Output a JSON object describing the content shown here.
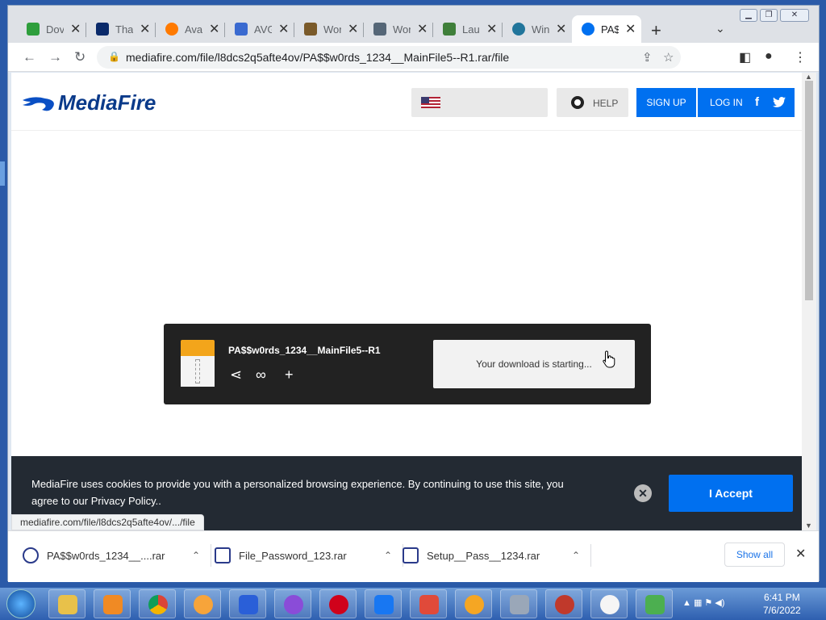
{
  "tabs": [
    {
      "label": "Dov",
      "color": "#2e9e3c"
    },
    {
      "label": "That",
      "color": "#0a2a6a"
    },
    {
      "label": "Ava",
      "color": "#ff7a00"
    },
    {
      "label": "AVG",
      "color": "#3a6ad0"
    },
    {
      "label": "Wor",
      "color": "#7a5a2a"
    },
    {
      "label": "Wor",
      "color": "#556677"
    },
    {
      "label": "Lau",
      "color": "#3f7f3a"
    },
    {
      "label": "Win",
      "color": "#21759b"
    },
    {
      "label": "PA$",
      "color": "#0070f0",
      "active": true
    }
  ],
  "address": {
    "url": "mediafire.com/file/l8dcs2q5afte4ov/PA$$w0rds_1234__MainFile5--R1.rar/file"
  },
  "header": {
    "logo": "MediaFire",
    "help": "HELP",
    "signup": "SIGN UP",
    "login": "LOG IN",
    "facebook": "f"
  },
  "download": {
    "filename": "PA$$w0rds_1234__MainFile5--R1",
    "message": "Your download is starting..."
  },
  "cookie": {
    "message": "MediaFire uses cookies to provide you with a personalized browsing experience. By continuing to use this site, you agree to our Privacy Policy..",
    "accept": "I Accept"
  },
  "status_url": "mediafire.com/file/l8dcs2q5afte4ov/.../file",
  "downloads": [
    {
      "name": "PA$$w0rds_1234__....rar"
    },
    {
      "name": "File_Password_123.rar"
    },
    {
      "name": "Setup__Pass__1234.rar"
    }
  ],
  "show_all": "Show all",
  "clock": {
    "time": "6:41 PM",
    "date": "7/6/2022"
  }
}
